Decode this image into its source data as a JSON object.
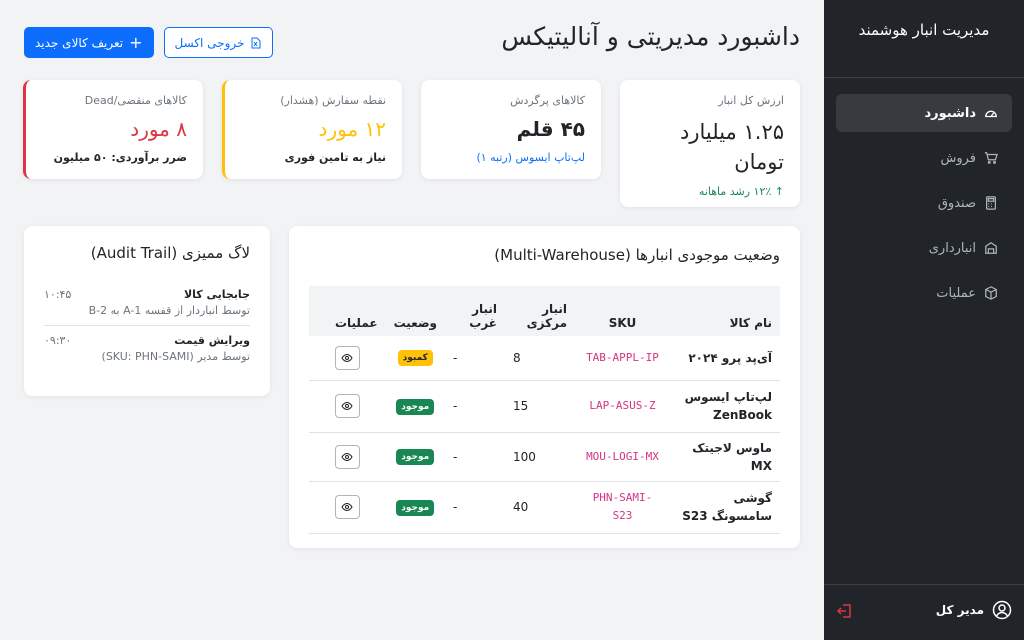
{
  "sidebar": {
    "brand": "مدیریت انبار هوشمند",
    "items": [
      {
        "label": "داشبورد",
        "icon": "speedometer-icon",
        "active": true
      },
      {
        "label": "فروش",
        "icon": "cart-icon"
      },
      {
        "label": "صندوق",
        "icon": "calculator-icon"
      },
      {
        "label": "انبارداری",
        "icon": "boxes-icon"
      },
      {
        "label": "عملیات",
        "icon": "box-icon"
      }
    ],
    "user": "مدیر کل"
  },
  "header": {
    "title": "داشبورد مدیریتی و آنالیتیکس",
    "excel_button": "خروجی اکسل",
    "new_item_button": "تعریف کالای جدید"
  },
  "stats": [
    {
      "label": "ارزش کل انبار",
      "value": "۱.۲۵ میلیارد تومان",
      "sub": "↑ ۱۲٪ رشد ماهانه",
      "sub_color": "#198754"
    },
    {
      "label": "کالاهای پرگردش",
      "value": "۴۵ قلم",
      "sub": "لپ‌تاپ ایسوس (رتبه ۱)",
      "sub_color": "#0d6efd"
    },
    {
      "label": "نقطه سفارش (هشدار)",
      "value": "۱۲ مورد",
      "value_color": "#ffc107",
      "sub": "نیاز به تامین فوری"
    },
    {
      "label": "کالاهای منقضی/Dead",
      "value": "۸ مورد",
      "value_color": "#dc3545",
      "sub": "ضرر برآوردی: ۵۰ میلیون"
    }
  ],
  "inventory": {
    "title": "وضعیت موجودی انبارها (Multi-Warehouse)",
    "columns": [
      "نام کالا",
      "SKU",
      "انبار مرکزی",
      "انبار غرب",
      "وضعیت",
      "عملیات"
    ],
    "rows": [
      {
        "name": "آی‌پد پرو ۲۰۲۴",
        "sku": "TAB-APPL-IP",
        "central": "8",
        "west": "-",
        "status": "کمبود",
        "status_type": "low"
      },
      {
        "name": "لپ‌تاپ ایسوس ZenBook",
        "sku": "LAP-ASUS-Z",
        "central": "15",
        "west": "-",
        "status": "موجود",
        "status_type": "ok"
      },
      {
        "name": "ماوس لاجیتک MX",
        "sku": "MOU-LOGI-MX",
        "central": "100",
        "west": "-",
        "status": "موجود",
        "status_type": "ok"
      },
      {
        "name": "گوشی سامسونگ S23",
        "sku": "PHN-SAMI-S23",
        "central": "40",
        "west": "-",
        "status": "موجود",
        "status_type": "ok"
      }
    ]
  },
  "audit": {
    "title": "لاگ ممیزی (Audit Trail)",
    "logs": [
      {
        "title": "جابجایی کالا",
        "desc": "توسط انباردار از قفسه A-1 به B-2",
        "time": "۱۰:۴۵"
      },
      {
        "title": "ویرایش قیمت",
        "desc": "توسط مدیر (SKU: PHN-SAMI)",
        "time": "۰۹:۳۰"
      }
    ]
  },
  "colors": {
    "primary": "#0d6efd",
    "sidebar": "#212529",
    "warning": "#ffc107",
    "danger": "#dc3545",
    "success": "#198754"
  }
}
